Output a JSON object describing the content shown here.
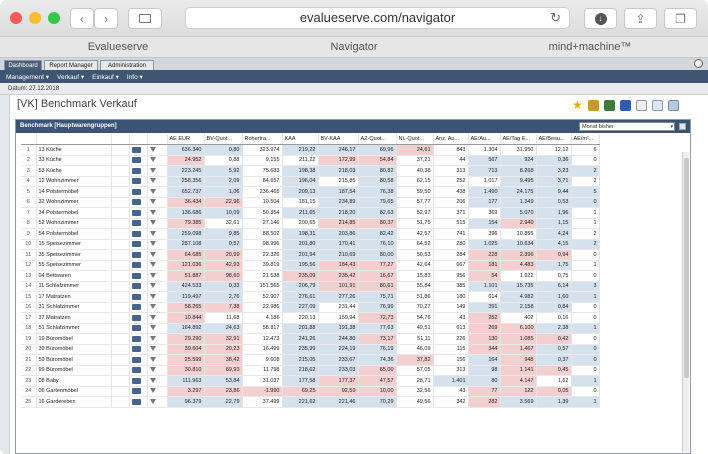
{
  "browser": {
    "url": "evalueserve.com/navigator"
  },
  "bookmarks": [
    "Evalueserve",
    "Navigator",
    "mind+machine™"
  ],
  "app_tabs": [
    "Dashboard",
    "Report Manager",
    "Administration"
  ],
  "menu": [
    "Management ▾",
    "Verkauf ▾",
    "Einkauf ▾",
    "Info ▾"
  ],
  "datum": "Datum: 27.12.2018",
  "page_title": "[VK] Benchmark Verkauf",
  "panel": {
    "title": "Benchmark [Hauptwarengruppen]",
    "period": "Monat bisher"
  },
  "columns": [
    "AE EUR",
    "BV-Quot...",
    "Rohertra...",
    "KAA",
    "BV-KAA",
    "AZ-Quot...",
    "NL-Quot...",
    "Anz. Au...",
    "AE/Au...",
    "AE/Tag E...",
    "AE/Besu...",
    "AE/m²..."
  ],
  "colors": {
    "header": "#3b5476",
    "blue_cell": "#d6e1ee",
    "pink_cell": "#f4cfd0"
  },
  "rows": [
    {
      "i": "1",
      "label": "13 Küche",
      "v": [
        "636.340",
        "0,80",
        "323.974",
        "219,22",
        "246,17",
        "69,96",
        "24,61",
        "843",
        "1.304",
        "31.950",
        "12,12",
        "6"
      ]
    },
    {
      "i": "2",
      "label": "33 Küche",
      "v": [
        "24.952",
        "0,88",
        "9.155",
        "211,22",
        "172,99",
        "54,84",
        "37,21",
        "44",
        "567",
        "924",
        "0,36",
        "0"
      ]
    },
    {
      "i": "3",
      "label": "53 Küche",
      "v": [
        "223.245",
        "5,92",
        "75.633",
        "198,38",
        "218,03",
        "80,82",
        "40,38",
        "313",
        "713",
        "8.268",
        "3,23",
        "2"
      ]
    },
    {
      "i": "4",
      "label": "12 Wohnzimmer",
      "v": [
        "258.356",
        "2,09",
        "84.657",
        "196,04",
        "215,85",
        "80,58",
        "62,15",
        "252",
        "1.017",
        "9.495",
        "3,71",
        "2"
      ]
    },
    {
      "i": "5",
      "label": "14 Polstermöbel",
      "v": [
        "652.737",
        "1,06",
        "236.465",
        "209,13",
        "187,54",
        "76,38",
        "59,50",
        "438",
        "1.490",
        "24.175",
        "9,44",
        "5"
      ]
    },
    {
      "i": "6",
      "label": "32 Wohnzimmer",
      "v": [
        "36.434",
        "22,96",
        "10.504",
        "181,15",
        "234,89",
        "79,65",
        "57,77",
        "206",
        "177",
        "1.349",
        "0,53",
        "0"
      ]
    },
    {
      "i": "7",
      "label": "34 Polstermöbel",
      "v": [
        "136.686",
        "10,09",
        "50.354",
        "211,65",
        "218,20",
        "82,63",
        "52,97",
        "371",
        "369",
        "5.070",
        "1,96",
        "1"
      ]
    },
    {
      "i": "8",
      "label": "52 Wohnzimmer",
      "v": [
        "79.385",
        "32,61",
        "27.146",
        "200,65",
        "214,85",
        "80,37",
        "51,75",
        "515",
        "154",
        "2.940",
        "1,15",
        "1"
      ]
    },
    {
      "i": "9",
      "label": "54 Polstermöbel",
      "v": [
        "259.098",
        "9,85",
        "88.502",
        "198,31",
        "203,86",
        "82,42",
        "42,57",
        "741",
        "396",
        "10.855",
        "4,24",
        "2"
      ]
    },
    {
      "i": "10",
      "label": "15 Speisezimmer",
      "v": [
        "287.108",
        "0,57",
        "98.996",
        "201,80",
        "170,41",
        "76,10",
        "64,52",
        "280",
        "1.025",
        "10.634",
        "4,15",
        "2"
      ]
    },
    {
      "i": "11",
      "label": "35 Speisezimmer",
      "v": [
        "64.685",
        "20,99",
        "22.326",
        "201,94",
        "210,69",
        "80,00",
        "50,53",
        "284",
        "228",
        "2.396",
        "0,94",
        "0"
      ]
    },
    {
      "i": "12",
      "label": "55 Speisezimmer",
      "v": [
        "121.036",
        "42,93",
        "39.819",
        "195,56",
        "184,43",
        "77,27",
        "42,64",
        "667",
        "181",
        "4.483",
        "1,75",
        "1"
      ]
    },
    {
      "i": "13",
      "label": "04 Bettwaren",
      "v": [
        "51.887",
        "98,60",
        "21.538",
        "235,09",
        "235,42",
        "16,67",
        "15,83",
        "956",
        "54",
        "1.922",
        "0,75",
        "0"
      ]
    },
    {
      "i": "14",
      "label": "11 Schlafzimmer",
      "v": [
        "424.533",
        "0,33",
        "151.565",
        "206,79",
        "101,91",
        "80,61",
        "55,84",
        "385",
        "1.101",
        "15.735",
        "6,14",
        "3"
      ]
    },
    {
      "i": "15",
      "label": "17 Matratzen",
      "v": [
        "119.497",
        "2,76",
        "52.907",
        "276,61",
        "277,26",
        "75,71",
        "51,86",
        "180",
        "614",
        "4.982",
        "1,60",
        "1"
      ]
    },
    {
      "i": "16",
      "label": "31 Schlafzimmer",
      "v": [
        "58.265",
        "7,38",
        "22.986",
        "227,09",
        "231,44",
        "76,99",
        "70,27",
        "149",
        "391",
        "2.158",
        "0,84",
        "0"
      ]
    },
    {
      "i": "17",
      "label": "37 Matratzen",
      "v": [
        "10.844",
        "11,68",
        "4.186",
        "220,13",
        "159,94",
        "72,73",
        "54,76",
        "43",
        "252",
        "402",
        "0,16",
        "0"
      ]
    },
    {
      "i": "18",
      "label": "51 Schlafzimmer",
      "v": [
        "164.892",
        "24,63",
        "58.817",
        "201,88",
        "191,38",
        "77,63",
        "49,51",
        "613",
        "269",
        "6.100",
        "2,38",
        "1"
      ]
    },
    {
      "i": "19",
      "label": "19 Büromöbel",
      "v": [
        "29.290",
        "32,91",
        "12.473",
        "241,26",
        "244,80",
        "73,17",
        "51,11",
        "226",
        "130",
        "1.085",
        "0,42",
        "0"
      ]
    },
    {
      "i": "20",
      "label": "39 Büromöbel",
      "v": [
        "39.604",
        "20,23",
        "16.499",
        "235,99",
        "224,19",
        "76,19",
        "46,09",
        "115",
        "344",
        "1.467",
        "0,57",
        "0"
      ]
    },
    {
      "i": "21",
      "label": "59 Büromöbel",
      "v": [
        "25.599",
        "38,42",
        "9.608",
        "215,05",
        "233,67",
        "74,36",
        "37,82",
        "156",
        "164",
        "948",
        "0,37",
        "0"
      ]
    },
    {
      "i": "22",
      "label": "99 Büromöbel",
      "v": [
        "30.810",
        "69,93",
        "11.798",
        "218,62",
        "233,03",
        "65,00",
        "57,05",
        "313",
        "98",
        "1.141",
        "0,45",
        "0"
      ]
    },
    {
      "i": "23",
      "label": "08 Baby",
      "v": [
        "111.963",
        "53,84",
        "31.037",
        "177,58",
        "177,37",
        "47,57",
        "28,71",
        "1.401",
        "80",
        "4.147",
        "1,62",
        "1"
      ]
    },
    {
      "i": "24",
      "label": "06 Gartenmöbel",
      "v": [
        "3.297",
        "23,86",
        "-1.990",
        "69,25",
        "92,59",
        "10,00",
        "32,56",
        "43",
        "77",
        "122",
        "0,05",
        "0"
      ]
    },
    {
      "i": "25",
      "label": "16 Gardereben",
      "v": [
        "96.379",
        "22,79",
        "37.499",
        "221,62",
        "221,46",
        "70,29",
        "49,56",
        "342",
        "282",
        "3.569",
        "1,39",
        "1"
      ]
    }
  ]
}
